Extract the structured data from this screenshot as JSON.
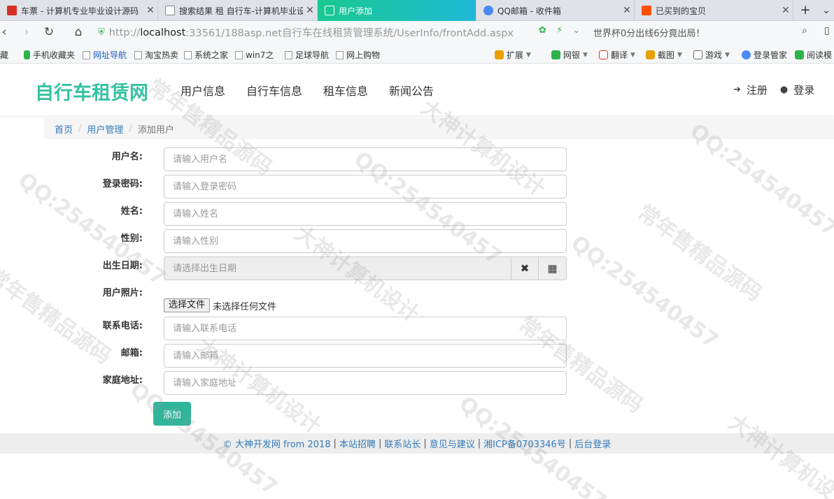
{
  "browser": {
    "tabs": [
      {
        "title": "车票 - 计算机专业毕业设计源码",
        "favicon_color": "#d93025",
        "active": false
      },
      {
        "title": "搜索结果 租 自行车-计算机毕业设计",
        "favicon_color": "#ffffff",
        "active": false
      },
      {
        "title": "用户添加",
        "favicon_color": "#ffffff",
        "active": true
      },
      {
        "title": "QQ邮箱 - 收件箱",
        "favicon_color": "#4a8af4",
        "active": false
      },
      {
        "title": "已买到的宝贝",
        "favicon_color": "#ff5000",
        "active": false
      }
    ],
    "new_tab": "+",
    "url_prefix": "http://",
    "url_host": "localhost",
    "url_rest": ":33561/188asp.net自行车在线租赁管理系统/UserInfo/frontAdd.aspx",
    "news_ticker": "世界杯0分出线6分竟出局！",
    "bookmarks_left": [
      "藏",
      "手机收藏夹",
      "网址导航",
      "淘宝热卖",
      "系统之家",
      "win7之",
      "足球导航",
      "网上购物"
    ],
    "bookmarks_right": [
      "扩展",
      "网银",
      "翻译",
      "截图",
      "游戏",
      "登录管家",
      "阅读模"
    ]
  },
  "site": {
    "brand": "自行车租赁网",
    "nav": [
      "用户信息",
      "自行车信息",
      "租车信息",
      "新闻公告"
    ],
    "register": "注册",
    "login": "登录"
  },
  "breadcrumb": {
    "home": "首页",
    "section": "用户管理",
    "current": "添加用户"
  },
  "form": {
    "username_label": "用户名:",
    "username_placeholder": "请输入用户名",
    "password_label": "登录密码:",
    "password_placeholder": "请输入登录密码",
    "name_label": "姓名:",
    "name_placeholder": "请输入姓名",
    "gender_label": "性别:",
    "gender_placeholder": "请输入性别",
    "birthday_label": "出生日期:",
    "birthday_placeholder": "请选择出生日期",
    "photo_label": "用户照片:",
    "file_button": "选择文件",
    "file_status": "未选择任何文件",
    "phone_label": "联系电话:",
    "phone_placeholder": "请输入联系电话",
    "email_label": "邮箱:",
    "email_placeholder": "请输入邮箱",
    "address_label": "家庭地址:",
    "address_placeholder": "请输入家庭地址",
    "submit": "添加"
  },
  "footer": {
    "copyright": "© 大神开发网 from 2018",
    "links": [
      "本站招聘",
      "联系站长",
      "意见与建议",
      "湘ICP备0703346号",
      "后台登录"
    ]
  },
  "watermark": [
    "QQ:254540457",
    "大神计算机设计",
    "常年售精品源码"
  ]
}
